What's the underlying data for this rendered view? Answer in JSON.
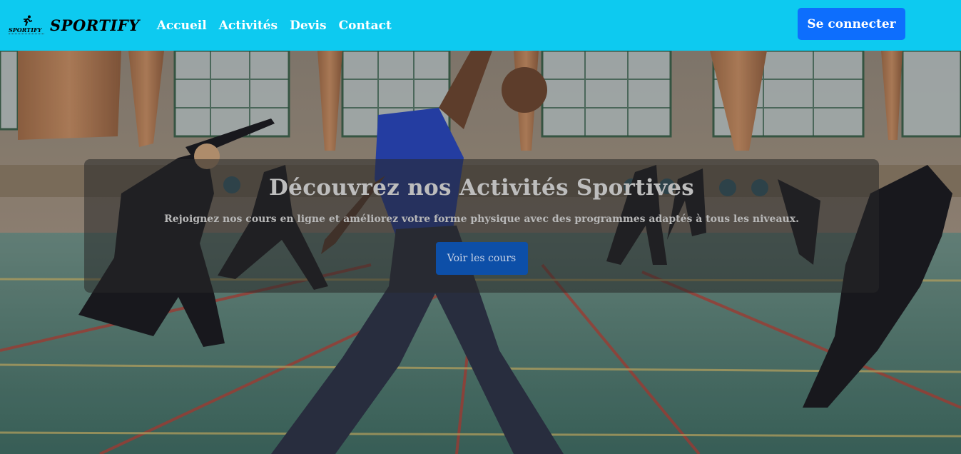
{
  "navbar": {
    "logo_text": "SPORTIFY",
    "brand_name": "SPORTIFY",
    "links": [
      {
        "label": "Accueil"
      },
      {
        "label": "Activités"
      },
      {
        "label": "Devis"
      },
      {
        "label": "Contact"
      }
    ],
    "login_label": "Se connecter"
  },
  "hero": {
    "title": "Découvrez nos Activités Sportives",
    "subtitle": "Rejoignez nos cours en ligne et améliorez votre forme physique avec des programmes adaptés à tous les niveaux.",
    "cta_label": "Voir les cours"
  },
  "colors": {
    "navbar_bg": "#0dcaf0",
    "login_bg": "#0d6efd",
    "cta_bg": "#0d4fa8"
  },
  "icons": {
    "logo": "runner-icon"
  }
}
